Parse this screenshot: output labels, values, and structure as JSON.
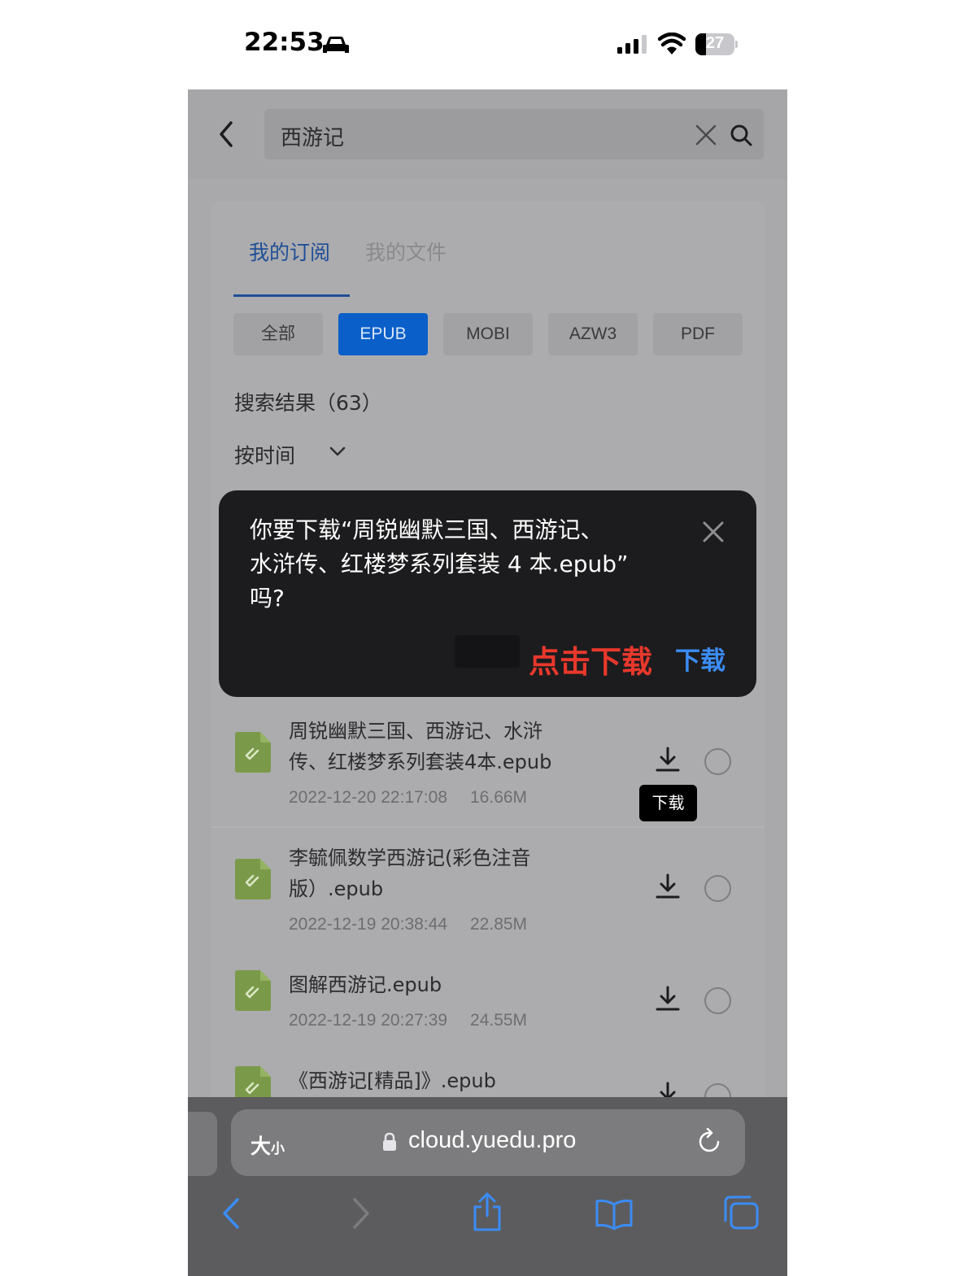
{
  "status_bar": {
    "time": "22:53",
    "battery_level": "27",
    "battery_fraction": 0.27
  },
  "search": {
    "query": "西游记"
  },
  "tabs": [
    {
      "label": "我的订阅",
      "active": true
    },
    {
      "label": "我的文件",
      "active": false
    }
  ],
  "filters": [
    {
      "label": "全部",
      "active": false
    },
    {
      "label": "EPUB",
      "active": true
    },
    {
      "label": "MOBI",
      "active": false
    },
    {
      "label": "AZW3",
      "active": false
    },
    {
      "label": "PDF",
      "active": false
    }
  ],
  "results": {
    "count_label": "搜索结果（63）",
    "sort_label": "按时间"
  },
  "files": [
    {
      "name_line1": "周锐幽默三国、西游记、水浒",
      "name_line2": "传、红楼梦系列套装4本.epub",
      "date": "2022-12-20 22:17:08",
      "size": "16.66M"
    },
    {
      "name_line1": "李毓佩数学西游记(彩色注音",
      "name_line2": "版）.epub",
      "date": "2022-12-19 20:38:44",
      "size": "22.85M"
    },
    {
      "name_line1": "图解西游记.epub",
      "name_line2": "",
      "date": "2022-12-19 20:27:39",
      "size": "24.55M"
    },
    {
      "name_line1": "《西游记[精品]》.epub",
      "name_line2": "",
      "date": "",
      "size": ""
    }
  ],
  "tooltip": {
    "label": "下载"
  },
  "download_prompt": {
    "line1": "你要下载“周锐幽默三国、西游记、",
    "line2": "水浒传、红楼梦系列套装 4 本.epub”",
    "line3": "吗?",
    "annotation": "点击下载",
    "action_label": "下载"
  },
  "browser": {
    "text_size_big": "大",
    "text_size_small": "小",
    "url": "cloud.yuedu.pro"
  },
  "colors": {
    "accent": "#0a5fc9",
    "popup_bg": "#1c1c1e",
    "annotation_red": "#e8382c",
    "download_blue": "#3b8cf6",
    "file_icon_green": "#7a9a4a"
  },
  "icons": {
    "status": [
      "car-icon",
      "signal-icon",
      "wifi-icon",
      "battery-icon"
    ],
    "toolbar": [
      "back-icon",
      "forward-icon",
      "share-icon",
      "bookmarks-icon",
      "tabs-icon"
    ]
  }
}
